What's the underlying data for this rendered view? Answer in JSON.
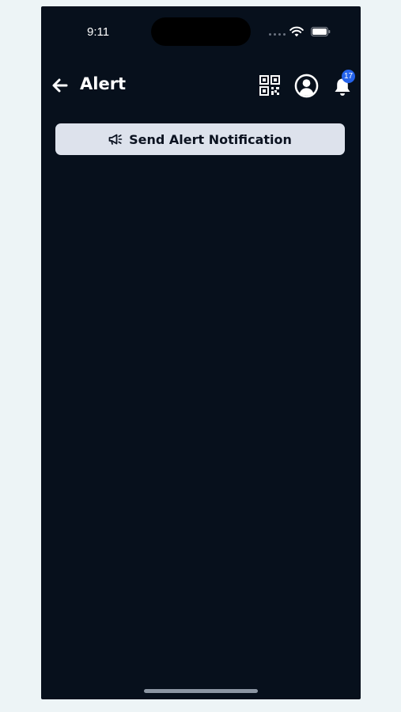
{
  "status_bar": {
    "time": "9:11"
  },
  "header": {
    "title": "Alert",
    "notification_count": "17"
  },
  "actions": {
    "send_alert_label": "Send Alert Notification"
  },
  "colors": {
    "background": "#07101c",
    "button_background": "#dde2ec",
    "badge": "#2563eb"
  },
  "icons": {
    "back": "arrow-left-icon",
    "qr": "qr-code-icon",
    "profile": "user-circle-icon",
    "notifications": "bell-icon",
    "send": "megaphone-icon"
  }
}
